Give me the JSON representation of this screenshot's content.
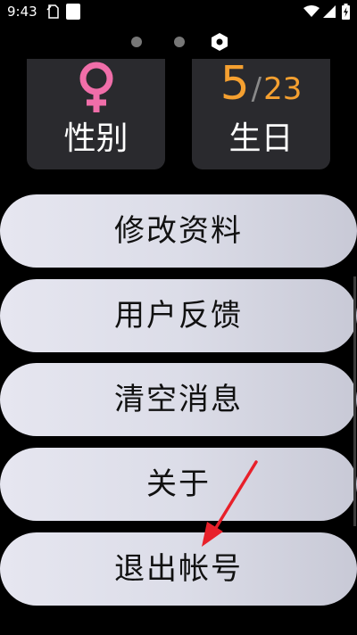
{
  "status_bar": {
    "time": "9:43",
    "icons": [
      "sim-card-icon",
      "notification-square-icon",
      "wifi-icon",
      "signal-icon",
      "battery-charging-icon"
    ]
  },
  "page_indicator": {
    "dots": [
      "page-dot",
      "page-dot",
      "settings-hexagon-icon"
    ]
  },
  "profile": {
    "gender": {
      "icon": "female-symbol-icon",
      "label": "性别",
      "icon_color": "#f06ea9"
    },
    "birthday": {
      "month": "5",
      "separator": "/",
      "day": "23",
      "label": "生日",
      "value_color": "#f5a030"
    }
  },
  "menu": {
    "items": [
      {
        "label": "修改资料"
      },
      {
        "label": "用户反馈"
      },
      {
        "label": "清空消息"
      },
      {
        "label": "关于"
      },
      {
        "label": "退出帐号"
      }
    ]
  },
  "annotation": {
    "icon": "red-arrow-icon",
    "color": "#e8202a"
  }
}
